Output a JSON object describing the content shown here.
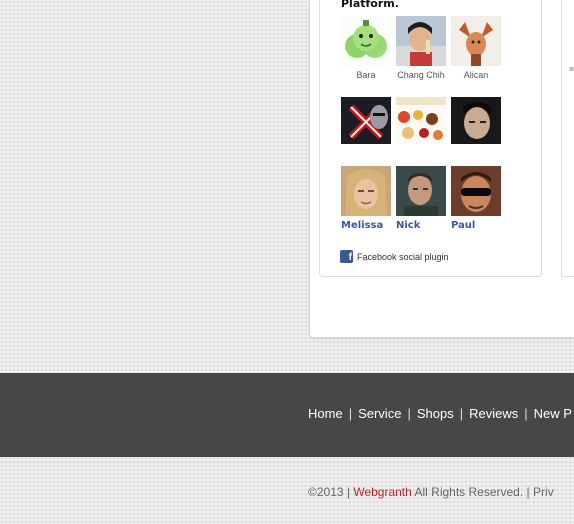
{
  "facebook_box": {
    "heading": "Platform.",
    "fans": [
      {
        "name": "Bara",
        "link": false,
        "icon": "green-cartoon-avatar"
      },
      {
        "name": "Chang Chih",
        "link": false,
        "icon": "person-photo-avatar"
      },
      {
        "name": "Alican",
        "link": false,
        "icon": "cartoon-character-avatar"
      },
      {
        "name": "",
        "link": false,
        "icon": "cross-logo-avatar"
      },
      {
        "name": "",
        "link": false,
        "icon": "food-collage-avatar"
      },
      {
        "name": "",
        "link": false,
        "icon": "dark-portrait-avatar"
      },
      {
        "name": "Melissa",
        "link": true,
        "icon": "blonde-woman-avatar"
      },
      {
        "name": "Nick",
        "link": true,
        "icon": "man-portrait-avatar"
      },
      {
        "name": "Paul",
        "link": true,
        "icon": "sunglasses-man-avatar"
      }
    ],
    "plugin_label": "Facebook social plugin",
    "plugin_icon": "facebook-icon"
  },
  "footer": {
    "nav": [
      "Home",
      "Service",
      "Shops",
      "Reviews",
      "New P"
    ],
    "copyright_prefix": "©2013 | ",
    "brand": "Webgranth",
    "copyright_suffix": " All Rights Reserved. | Priv"
  }
}
